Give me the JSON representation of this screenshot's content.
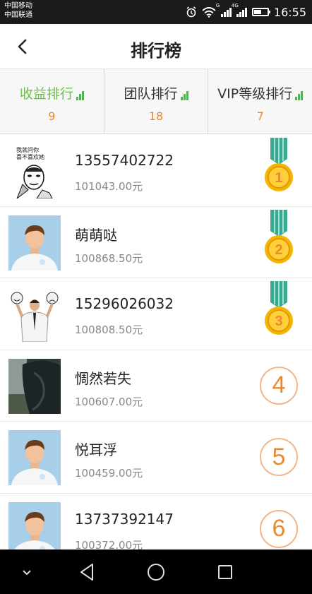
{
  "status_bar": {
    "carrier_1": "中国移动",
    "carrier_2": "中国联通",
    "time": "16:55",
    "battery_level": 0.55,
    "icons": [
      "alarm-icon",
      "wifi-icon",
      "signal-icon",
      "signal-4g-icon",
      "battery-icon"
    ]
  },
  "header": {
    "title": "排行榜",
    "back_icon": "chevron-left-icon"
  },
  "tabs": [
    {
      "label": "收益排行",
      "count": "9",
      "active": true
    },
    {
      "label": "团队排行",
      "count": "18",
      "active": false
    },
    {
      "label": "VIP等级排行",
      "count": "7",
      "active": false
    }
  ],
  "rankings": [
    {
      "name": "13557402722",
      "amount": "101043.00元",
      "rank": "1",
      "avatar_text": "我就问你喜不喜欢她",
      "avatar": "meme-avatar"
    },
    {
      "name": "萌萌哒",
      "amount": "100868.50元",
      "rank": "2",
      "avatar": "default-avatar"
    },
    {
      "name": "15296026032",
      "amount": "100808.50元",
      "rank": "3",
      "avatar": "businessman-avatar"
    },
    {
      "name": "惆然若失",
      "amount": "100607.00元",
      "rank": "4",
      "avatar": "photo-avatar"
    },
    {
      "name": "悦耳浮",
      "amount": "100459.00元",
      "rank": "5",
      "avatar": "default-avatar"
    },
    {
      "name": "13737392147",
      "amount": "100372.00元",
      "rank": "6",
      "avatar": "default-avatar"
    }
  ],
  "colors": {
    "accent_green": "#6dbf4a",
    "count_orange": "#e98a2f",
    "medal_gold": "#f5b400",
    "ribbon_teal": "#3aa992"
  },
  "nav_bar": {
    "icons": [
      "hide-keyboard-icon",
      "back-triangle-icon",
      "home-circle-icon",
      "recents-square-icon"
    ]
  }
}
